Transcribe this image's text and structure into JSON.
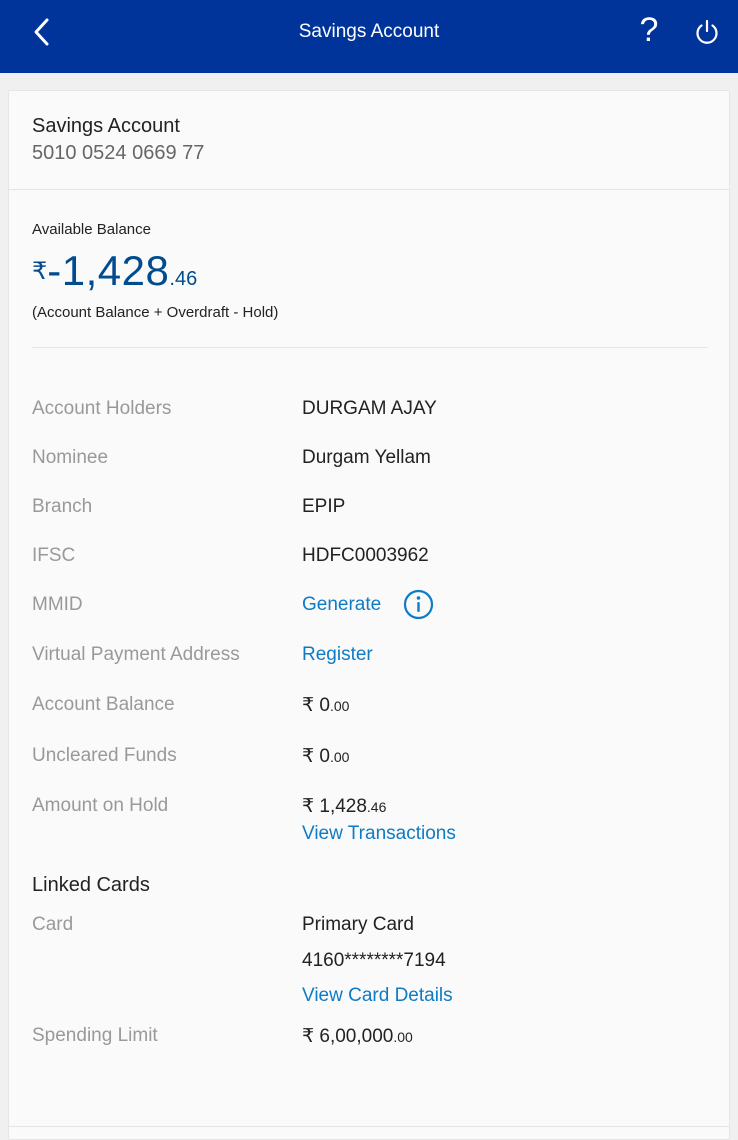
{
  "header": {
    "title": "Savings Account",
    "help_label": "?"
  },
  "account": {
    "name": "Savings Account",
    "number": "5010 0524 0669 77"
  },
  "balance": {
    "label": "Available Balance",
    "currency": "₹",
    "sign": "-",
    "amount_main": "1,428",
    "amount_decimal": ".46",
    "note": "(Account Balance + Overdraft - Hold)"
  },
  "details": {
    "account_holders": {
      "label": "Account Holders",
      "value": "DURGAM AJAY"
    },
    "nominee": {
      "label": "Nominee",
      "value": "Durgam Yellam"
    },
    "branch": {
      "label": "Branch",
      "value": "EPIP"
    },
    "ifsc": {
      "label": "IFSC",
      "value": "HDFC0003962"
    },
    "mmid": {
      "label": "MMID",
      "link": "Generate"
    },
    "vpa": {
      "label": "Virtual Payment Address",
      "link": "Register"
    },
    "account_balance": {
      "label": "Account Balance",
      "currency": "₹",
      "main": "0",
      "decimal": ".00"
    },
    "uncleared_funds": {
      "label": "Uncleared Funds",
      "currency": "₹",
      "main": "0",
      "decimal": ".00"
    },
    "amount_on_hold": {
      "label": "Amount on Hold",
      "currency": "₹",
      "main": "1,428",
      "decimal": ".46",
      "link": "View Transactions"
    }
  },
  "linked_cards": {
    "title": "Linked Cards",
    "card_label": "Card",
    "card_type": "Primary Card",
    "card_number": "4160********7194",
    "card_link": "View Card Details",
    "spending_limit": {
      "label": "Spending Limit",
      "currency": "₹",
      "main": "6,00,000",
      "decimal": ".00"
    }
  },
  "colors": {
    "header_bg": "#00349b",
    "balance": "#004c8f",
    "link": "#0f7bc4",
    "label_gray": "#999999"
  },
  "icons": [
    "back-chevron-icon",
    "help-icon",
    "power-icon",
    "info-icon"
  ]
}
